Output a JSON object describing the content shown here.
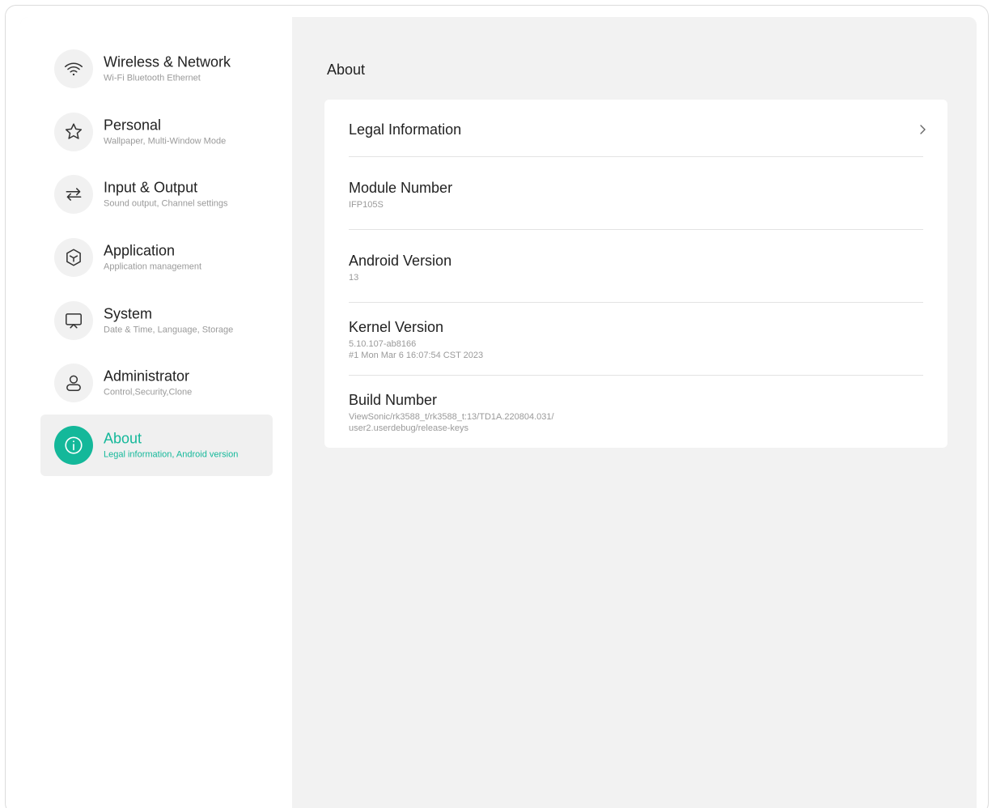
{
  "sidebar": {
    "items": [
      {
        "title": "Wireless & Network",
        "subtitle": "Wi-Fi Bluetooth Ethernet",
        "icon": "wifi-icon"
      },
      {
        "title": "Personal",
        "subtitle": "Wallpaper, Multi-Window Mode",
        "icon": "star-icon"
      },
      {
        "title": "Input & Output",
        "subtitle": "Sound output, Channel settings",
        "icon": "swap-arrows-icon"
      },
      {
        "title": "Application",
        "subtitle": "Application management",
        "icon": "cube-icon"
      },
      {
        "title": "System",
        "subtitle": "Date & Time, Language, Storage",
        "icon": "monitor-icon"
      },
      {
        "title": "Administrator",
        "subtitle": "Control,Security,Clone",
        "icon": "user-icon"
      },
      {
        "title": "About",
        "subtitle": "Legal information, Android version",
        "icon": "info-icon",
        "active": true
      }
    ]
  },
  "main": {
    "title": "About",
    "rows": [
      {
        "title": "Legal Information",
        "icon": "chevron-right-icon"
      },
      {
        "title": "Module Number",
        "value": "IFP105S"
      },
      {
        "title": "Android Version",
        "value": "13"
      },
      {
        "title": "Kernel Version",
        "value_lines": [
          "5.10.107-ab8166",
          "#1 Mon Mar 6 16:07:54 CST 2023"
        ]
      },
      {
        "title": "Build Number",
        "value_lines": [
          "ViewSonic/rk3588_t/rk3588_t:13/TD1A.220804.031/",
          "user2.userdebug/release-keys"
        ]
      }
    ]
  },
  "colors": {
    "accent": "#14b89a",
    "background": "#f2f2f2",
    "sidebar": "#ffffff",
    "active_item": "#f0f0f0"
  }
}
